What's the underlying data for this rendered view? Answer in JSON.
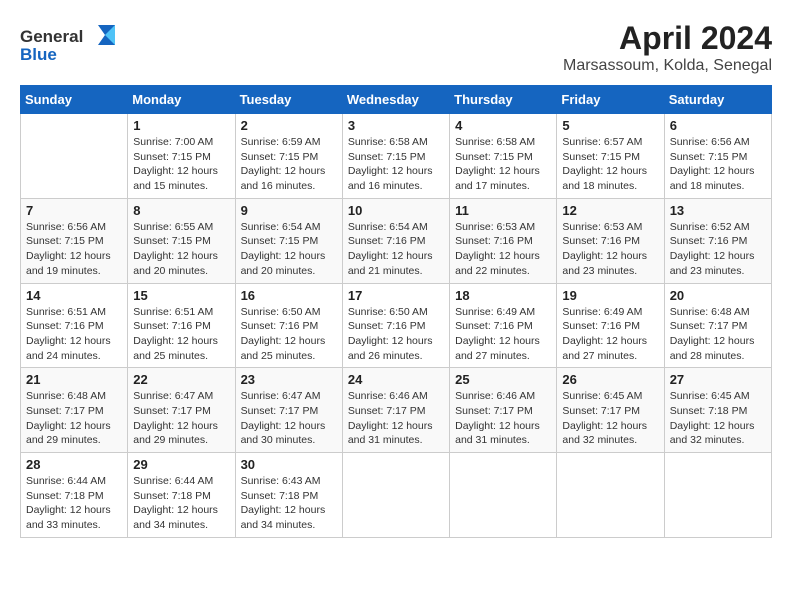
{
  "logo": {
    "text_general": "General",
    "text_blue": "Blue"
  },
  "title": "April 2024",
  "subtitle": "Marsassoum, Kolda, Senegal",
  "headers": [
    "Sunday",
    "Monday",
    "Tuesday",
    "Wednesday",
    "Thursday",
    "Friday",
    "Saturday"
  ],
  "weeks": [
    [
      {
        "day": "",
        "info": ""
      },
      {
        "day": "1",
        "info": "Sunrise: 7:00 AM\nSunset: 7:15 PM\nDaylight: 12 hours\nand 15 minutes."
      },
      {
        "day": "2",
        "info": "Sunrise: 6:59 AM\nSunset: 7:15 PM\nDaylight: 12 hours\nand 16 minutes."
      },
      {
        "day": "3",
        "info": "Sunrise: 6:58 AM\nSunset: 7:15 PM\nDaylight: 12 hours\nand 16 minutes."
      },
      {
        "day": "4",
        "info": "Sunrise: 6:58 AM\nSunset: 7:15 PM\nDaylight: 12 hours\nand 17 minutes."
      },
      {
        "day": "5",
        "info": "Sunrise: 6:57 AM\nSunset: 7:15 PM\nDaylight: 12 hours\nand 18 minutes."
      },
      {
        "day": "6",
        "info": "Sunrise: 6:56 AM\nSunset: 7:15 PM\nDaylight: 12 hours\nand 18 minutes."
      }
    ],
    [
      {
        "day": "7",
        "info": "Sunrise: 6:56 AM\nSunset: 7:15 PM\nDaylight: 12 hours\nand 19 minutes."
      },
      {
        "day": "8",
        "info": "Sunrise: 6:55 AM\nSunset: 7:15 PM\nDaylight: 12 hours\nand 20 minutes."
      },
      {
        "day": "9",
        "info": "Sunrise: 6:54 AM\nSunset: 7:15 PM\nDaylight: 12 hours\nand 20 minutes."
      },
      {
        "day": "10",
        "info": "Sunrise: 6:54 AM\nSunset: 7:16 PM\nDaylight: 12 hours\nand 21 minutes."
      },
      {
        "day": "11",
        "info": "Sunrise: 6:53 AM\nSunset: 7:16 PM\nDaylight: 12 hours\nand 22 minutes."
      },
      {
        "day": "12",
        "info": "Sunrise: 6:53 AM\nSunset: 7:16 PM\nDaylight: 12 hours\nand 23 minutes."
      },
      {
        "day": "13",
        "info": "Sunrise: 6:52 AM\nSunset: 7:16 PM\nDaylight: 12 hours\nand 23 minutes."
      }
    ],
    [
      {
        "day": "14",
        "info": "Sunrise: 6:51 AM\nSunset: 7:16 PM\nDaylight: 12 hours\nand 24 minutes."
      },
      {
        "day": "15",
        "info": "Sunrise: 6:51 AM\nSunset: 7:16 PM\nDaylight: 12 hours\nand 25 minutes."
      },
      {
        "day": "16",
        "info": "Sunrise: 6:50 AM\nSunset: 7:16 PM\nDaylight: 12 hours\nand 25 minutes."
      },
      {
        "day": "17",
        "info": "Sunrise: 6:50 AM\nSunset: 7:16 PM\nDaylight: 12 hours\nand 26 minutes."
      },
      {
        "day": "18",
        "info": "Sunrise: 6:49 AM\nSunset: 7:16 PM\nDaylight: 12 hours\nand 27 minutes."
      },
      {
        "day": "19",
        "info": "Sunrise: 6:49 AM\nSunset: 7:16 PM\nDaylight: 12 hours\nand 27 minutes."
      },
      {
        "day": "20",
        "info": "Sunrise: 6:48 AM\nSunset: 7:17 PM\nDaylight: 12 hours\nand 28 minutes."
      }
    ],
    [
      {
        "day": "21",
        "info": "Sunrise: 6:48 AM\nSunset: 7:17 PM\nDaylight: 12 hours\nand 29 minutes."
      },
      {
        "day": "22",
        "info": "Sunrise: 6:47 AM\nSunset: 7:17 PM\nDaylight: 12 hours\nand 29 minutes."
      },
      {
        "day": "23",
        "info": "Sunrise: 6:47 AM\nSunset: 7:17 PM\nDaylight: 12 hours\nand 30 minutes."
      },
      {
        "day": "24",
        "info": "Sunrise: 6:46 AM\nSunset: 7:17 PM\nDaylight: 12 hours\nand 31 minutes."
      },
      {
        "day": "25",
        "info": "Sunrise: 6:46 AM\nSunset: 7:17 PM\nDaylight: 12 hours\nand 31 minutes."
      },
      {
        "day": "26",
        "info": "Sunrise: 6:45 AM\nSunset: 7:17 PM\nDaylight: 12 hours\nand 32 minutes."
      },
      {
        "day": "27",
        "info": "Sunrise: 6:45 AM\nSunset: 7:18 PM\nDaylight: 12 hours\nand 32 minutes."
      }
    ],
    [
      {
        "day": "28",
        "info": "Sunrise: 6:44 AM\nSunset: 7:18 PM\nDaylight: 12 hours\nand 33 minutes."
      },
      {
        "day": "29",
        "info": "Sunrise: 6:44 AM\nSunset: 7:18 PM\nDaylight: 12 hours\nand 34 minutes."
      },
      {
        "day": "30",
        "info": "Sunrise: 6:43 AM\nSunset: 7:18 PM\nDaylight: 12 hours\nand 34 minutes."
      },
      {
        "day": "",
        "info": ""
      },
      {
        "day": "",
        "info": ""
      },
      {
        "day": "",
        "info": ""
      },
      {
        "day": "",
        "info": ""
      }
    ]
  ]
}
